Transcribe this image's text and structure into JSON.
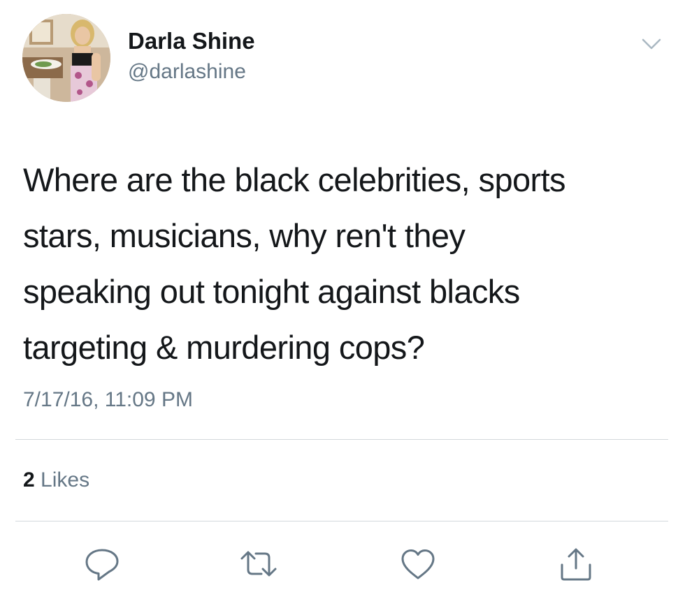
{
  "user": {
    "display_name": "Darla Shine",
    "handle": "@darlashine"
  },
  "tweet": {
    "text": "Where are the black celebrities, sports\nstars, musicians, why ren't they\nspeaking out tonight against blacks\ntargeting & murdering cops?",
    "timestamp": "7/17/16, 11:09 PM"
  },
  "stats": {
    "likes_count": "2",
    "likes_label": "Likes"
  },
  "actions": {
    "icons": [
      "reply-icon",
      "retweet-icon",
      "like-icon",
      "share-icon"
    ]
  },
  "colors": {
    "primary_text": "#14171a",
    "secondary_text": "#657786",
    "divider": "#d3d8dc",
    "icon": "#657786"
  }
}
